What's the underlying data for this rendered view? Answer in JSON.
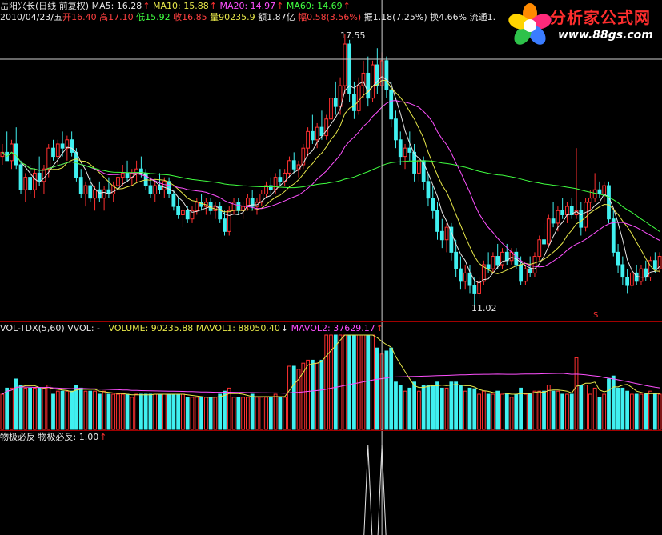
{
  "header": {
    "stock": "岳阳兴长(日线 前复权)",
    "ma5": "MA5: 16.28",
    "ma10": "MA10: 15.88",
    "ma20": "MA20: 14.97",
    "ma60": "MA60: 14.69"
  },
  "quote": {
    "date": "2010/04/23/五",
    "open_label": "开",
    "open": "16.40",
    "high_label": "高",
    "high": "17.10",
    "low_label": "低",
    "low": "15.92",
    "close_label": "收",
    "close": "16.85",
    "vol_label": "量",
    "vol": "90235.9",
    "amount": "额1.87亿",
    "chg_label": "幅",
    "chg": "0.58(3.56%)",
    "amp": "振1.18(7.25%)",
    "turnover": "换4.66%",
    "float": "流通1."
  },
  "price_marks": {
    "high_label": "17.55",
    "low_label": "11.02",
    "s_mark": "S"
  },
  "volume_header": {
    "name": "VOL-TDX(5,60)",
    "vvol": "VVOL: -",
    "volume": "VOLUME: 90235.88",
    "mavol1": "MAVOL1: 88050.40",
    "mavol2": "MAVOL2: 37629.17"
  },
  "indicator_header": {
    "name": "物极必反",
    "value": "物极必反: 1.00"
  },
  "logo": {
    "brand": "分析家公式网",
    "site": "www.88gs.com"
  },
  "colors": {
    "up": "#ff3030",
    "down": "#40f0f0",
    "ma5": "#e6e6e6",
    "ma10": "#e8e84a",
    "ma20": "#ff50ff",
    "ma60": "#40ff40",
    "mavol1": "#e8e84a",
    "mavol2": "#ff50ff"
  },
  "chart_data": {
    "type": "candlestick",
    "price_axis": {
      "max": 17.55,
      "min": 11.02
    },
    "crosshair_index": 82,
    "candles": [
      [
        14.6,
        14.9,
        14.4,
        14.7
      ],
      [
        14.7,
        15.2,
        14.5,
        14.5
      ],
      [
        14.5,
        15.0,
        14.3,
        14.9
      ],
      [
        14.9,
        15.3,
        14.3,
        14.4
      ],
      [
        14.4,
        14.5,
        13.7,
        13.8
      ],
      [
        13.8,
        14.2,
        13.5,
        14.1
      ],
      [
        14.1,
        14.4,
        13.7,
        13.8
      ],
      [
        13.8,
        14.3,
        13.6,
        14.2
      ],
      [
        14.2,
        14.6,
        13.9,
        14.0
      ],
      [
        14.0,
        14.4,
        13.7,
        14.3
      ],
      [
        14.3,
        14.9,
        14.1,
        14.8
      ],
      [
        14.8,
        15.0,
        14.5,
        14.6
      ],
      [
        14.6,
        15.0,
        14.4,
        14.9
      ],
      [
        14.9,
        15.2,
        14.6,
        14.8
      ],
      [
        14.8,
        15.1,
        14.5,
        15.0
      ],
      [
        15.0,
        15.2,
        14.6,
        14.7
      ],
      [
        14.7,
        14.8,
        14.0,
        14.1
      ],
      [
        14.1,
        14.3,
        13.6,
        13.7
      ],
      [
        13.7,
        14.0,
        13.4,
        13.9
      ],
      [
        13.9,
        14.1,
        13.5,
        13.6
      ],
      [
        13.6,
        13.9,
        13.3,
        13.8
      ],
      [
        13.8,
        14.0,
        13.5,
        13.6
      ],
      [
        13.6,
        13.9,
        13.3,
        13.8
      ],
      [
        13.8,
        14.1,
        13.6,
        13.7
      ],
      [
        13.7,
        14.0,
        13.5,
        13.9
      ],
      [
        13.9,
        14.3,
        13.8,
        14.1
      ],
      [
        14.1,
        14.4,
        13.9,
        14.2
      ],
      [
        14.2,
        14.5,
        14.0,
        14.1
      ],
      [
        14.1,
        14.3,
        13.9,
        14.2
      ],
      [
        14.2,
        14.5,
        14.0,
        14.3
      ],
      [
        14.3,
        14.6,
        14.1,
        14.2
      ],
      [
        14.2,
        14.3,
        13.8,
        13.9
      ],
      [
        13.9,
        14.1,
        13.6,
        13.7
      ],
      [
        13.7,
        14.0,
        13.5,
        13.9
      ],
      [
        13.9,
        14.2,
        13.7,
        13.8
      ],
      [
        13.8,
        14.1,
        13.6,
        14.0
      ],
      [
        14.0,
        14.1,
        13.6,
        13.7
      ],
      [
        13.7,
        13.8,
        13.3,
        13.4
      ],
      [
        13.4,
        13.6,
        13.1,
        13.2
      ],
      [
        13.2,
        13.4,
        12.9,
        13.3
      ],
      [
        13.3,
        13.4,
        13.0,
        13.1
      ],
      [
        13.1,
        13.4,
        13.0,
        13.3
      ],
      [
        13.3,
        13.6,
        13.2,
        13.5
      ],
      [
        13.5,
        13.7,
        13.3,
        13.4
      ],
      [
        13.4,
        13.6,
        13.2,
        13.5
      ],
      [
        13.5,
        13.6,
        13.2,
        13.3
      ],
      [
        13.3,
        13.5,
        13.1,
        13.4
      ],
      [
        13.4,
        13.5,
        13.0,
        13.1
      ],
      [
        13.1,
        13.3,
        12.7,
        12.8
      ],
      [
        12.8,
        13.4,
        12.7,
        13.3
      ],
      [
        13.3,
        13.6,
        13.2,
        13.5
      ],
      [
        13.5,
        13.6,
        13.2,
        13.3
      ],
      [
        13.3,
        13.5,
        13.1,
        13.4
      ],
      [
        13.4,
        13.7,
        13.3,
        13.6
      ],
      [
        13.6,
        13.8,
        13.3,
        13.4
      ],
      [
        13.4,
        13.6,
        13.2,
        13.5
      ],
      [
        13.5,
        13.8,
        13.4,
        13.7
      ],
      [
        13.7,
        14.0,
        13.6,
        13.9
      ],
      [
        13.9,
        14.1,
        13.7,
        13.8
      ],
      [
        13.8,
        14.2,
        13.7,
        14.1
      ],
      [
        14.1,
        14.3,
        13.9,
        14.0
      ],
      [
        14.0,
        14.3,
        13.9,
        14.2
      ],
      [
        14.2,
        14.6,
        14.1,
        14.5
      ],
      [
        14.5,
        14.7,
        14.2,
        14.3
      ],
      [
        14.3,
        14.5,
        14.1,
        14.4
      ],
      [
        14.4,
        14.9,
        14.3,
        14.8
      ],
      [
        14.8,
        15.3,
        14.6,
        15.2
      ],
      [
        15.2,
        15.6,
        14.9,
        15.0
      ],
      [
        15.0,
        15.4,
        14.8,
        15.3
      ],
      [
        15.3,
        15.7,
        15.0,
        15.1
      ],
      [
        15.1,
        15.6,
        15.0,
        15.5
      ],
      [
        15.5,
        16.2,
        15.3,
        16.0
      ],
      [
        16.0,
        16.4,
        15.6,
        15.8
      ],
      [
        15.8,
        16.5,
        15.6,
        16.3
      ],
      [
        16.3,
        17.55,
        16.1,
        17.3
      ],
      [
        17.3,
        17.4,
        15.9,
        16.1
      ],
      [
        16.1,
        16.4,
        15.5,
        15.7
      ],
      [
        15.7,
        16.5,
        15.6,
        16.3
      ],
      [
        16.3,
        16.9,
        16.0,
        16.6
      ],
      [
        16.6,
        17.0,
        15.8,
        16.0
      ],
      [
        16.0,
        16.9,
        15.9,
        16.8
      ],
      [
        16.8,
        17.2,
        16.1,
        16.3
      ],
      [
        16.3,
        17.1,
        16.2,
        16.9
      ],
      [
        16.9,
        17.0,
        16.0,
        16.2
      ],
      [
        16.2,
        16.4,
        15.3,
        15.5
      ],
      [
        15.5,
        15.7,
        14.8,
        15.0
      ],
      [
        15.0,
        15.2,
        14.4,
        14.6
      ],
      [
        14.6,
        14.9,
        14.3,
        14.8
      ],
      [
        14.8,
        15.2,
        14.5,
        14.7
      ],
      [
        14.7,
        14.9,
        14.0,
        14.2
      ],
      [
        14.2,
        14.6,
        14.0,
        14.5
      ],
      [
        14.5,
        14.6,
        13.8,
        14.0
      ],
      [
        14.0,
        14.2,
        13.4,
        13.6
      ],
      [
        13.6,
        13.9,
        13.1,
        13.3
      ],
      [
        13.3,
        13.5,
        12.6,
        12.8
      ],
      [
        12.8,
        13.1,
        12.4,
        12.6
      ],
      [
        12.6,
        13.0,
        12.3,
        12.9
      ],
      [
        12.9,
        13.0,
        12.1,
        12.3
      ],
      [
        12.3,
        12.6,
        11.7,
        11.9
      ],
      [
        11.9,
        12.2,
        11.4,
        11.6
      ],
      [
        11.6,
        12.0,
        11.4,
        11.8
      ],
      [
        11.8,
        12.0,
        11.3,
        11.5
      ],
      [
        11.5,
        11.7,
        11.02,
        11.3
      ],
      [
        11.3,
        11.7,
        11.2,
        11.6
      ],
      [
        11.6,
        12.1,
        11.5,
        12.0
      ],
      [
        12.0,
        12.3,
        11.8,
        11.9
      ],
      [
        11.9,
        12.3,
        11.8,
        12.2
      ],
      [
        12.2,
        12.5,
        11.9,
        12.0
      ],
      [
        12.0,
        12.4,
        11.9,
        12.3
      ],
      [
        12.3,
        12.5,
        12.0,
        12.1
      ],
      [
        12.1,
        12.4,
        12.0,
        12.3
      ],
      [
        12.3,
        12.4,
        11.9,
        12.0
      ],
      [
        12.0,
        12.2,
        11.5,
        11.6
      ],
      [
        11.6,
        12.0,
        11.5,
        11.9
      ],
      [
        11.9,
        12.2,
        11.7,
        11.8
      ],
      [
        11.8,
        12.3,
        11.7,
        12.2
      ],
      [
        12.2,
        12.7,
        12.1,
        12.6
      ],
      [
        12.6,
        13.0,
        12.4,
        12.5
      ],
      [
        12.5,
        13.2,
        12.4,
        13.1
      ],
      [
        13.1,
        13.5,
        12.9,
        13.0
      ],
      [
        13.0,
        13.4,
        12.8,
        13.3
      ],
      [
        13.3,
        13.6,
        13.1,
        13.2
      ],
      [
        13.2,
        13.5,
        13.0,
        13.4
      ],
      [
        13.4,
        13.6,
        13.1,
        13.2
      ],
      [
        13.2,
        14.8,
        13.1,
        13.3
      ],
      [
        13.3,
        13.5,
        12.7,
        12.9
      ],
      [
        12.9,
        13.6,
        12.8,
        13.5
      ],
      [
        13.5,
        13.8,
        13.3,
        13.6
      ],
      [
        13.6,
        14.2,
        13.5,
        13.8
      ],
      [
        13.8,
        14.0,
        13.6,
        13.7
      ],
      [
        13.7,
        14.0,
        13.5,
        13.9
      ],
      [
        13.9,
        14.0,
        13.0,
        13.1
      ],
      [
        13.1,
        13.3,
        12.2,
        12.3
      ],
      [
        12.3,
        12.5,
        11.8,
        12.0
      ],
      [
        12.0,
        12.2,
        11.5,
        11.7
      ],
      [
        11.7,
        11.9,
        11.3,
        11.5
      ],
      [
        11.5,
        11.9,
        11.4,
        11.8
      ],
      [
        11.8,
        12.0,
        11.5,
        11.6
      ],
      [
        11.6,
        12.0,
        11.5,
        11.9
      ],
      [
        11.9,
        12.1,
        11.6,
        11.7
      ],
      [
        11.7,
        12.2,
        11.6,
        12.1
      ],
      [
        12.1,
        12.3,
        11.8,
        11.9
      ],
      [
        11.9,
        12.3,
        11.8,
        12.2
      ]
    ],
    "volumes": [],
    "indicator_spikes": [
      79,
      82
    ]
  }
}
